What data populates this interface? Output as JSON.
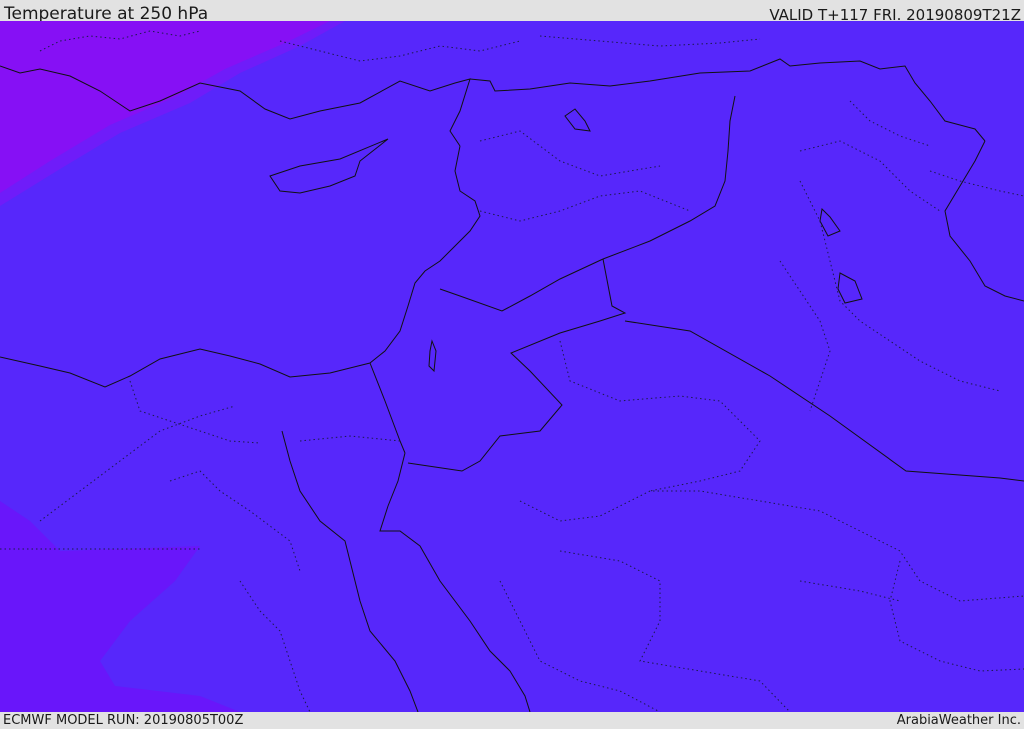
{
  "header": {
    "title": "Temperature at 250 hPa",
    "valid": "VALID T+117 FRI. 20190809T21Z"
  },
  "footer": {
    "model_run": "ECMWF MODEL RUN: 20190805T00Z",
    "credit": "ArabiaWeather Inc."
  },
  "map": {
    "colors": {
      "field_main": "#5727fb",
      "field_cold_nw": "#8610f5",
      "field_cold_nw_edge": "#6f1cf9",
      "field_cold_sw": "#6916fa",
      "coast": "#111111",
      "border": "#111111",
      "admin": "#1a1a4a"
    }
  }
}
